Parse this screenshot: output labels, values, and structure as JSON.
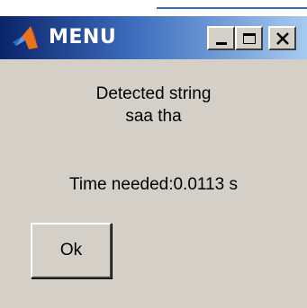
{
  "window": {
    "title": "MENU",
    "app_icon": "matlab-logo-icon",
    "controls": {
      "minimize_icon": "minimize-icon",
      "maximize_icon": "maximize-icon",
      "close_icon": "close-icon"
    }
  },
  "message": {
    "line1": "Detected string",
    "line2": "saa tha",
    "time_label": "Time needed:0.0113 s"
  },
  "buttons": {
    "ok_label": "Ok"
  },
  "colors": {
    "titlebar_start": "#0a246a",
    "titlebar_end": "#a6caf0",
    "dialog_face": "#d4d0c8",
    "title_text": "#ffffff"
  }
}
